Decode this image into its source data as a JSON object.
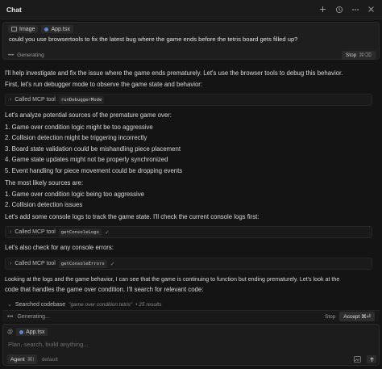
{
  "header": {
    "title": "Chat",
    "icons": [
      "plus-icon",
      "history-icon",
      "more-icon",
      "close-icon"
    ]
  },
  "message": {
    "chips": {
      "image": "Image",
      "file": "App.tsx"
    },
    "text": "could you use browsertools to fix the latest bug where the game ends before the tetris board gets filled up?",
    "status": "Generating",
    "stop_label": "Stop",
    "stop_shortcut": "⌘⌫"
  },
  "conversation": {
    "p1": "I'll help investigate and fix the issue where the game ends prematurely. Let's use the browser tools to debug this behavior.",
    "p2": "First, let's run debugger mode to observe the game state and behavior:",
    "tool1": {
      "label": "Called MCP tool",
      "name": "runDebuggerMode"
    },
    "p3": "Let's analyze potential sources of the premature game over:",
    "list1": [
      "1. Game over condition logic might be too aggressive",
      "2. Collision detection might be triggering incorrectly",
      "3. Board state validation could be mishandling piece placement",
      "4. Game state updates might not be properly synchronized",
      "5. Event handling for piece movement could be dropping events"
    ],
    "p4": "The most likely sources are:",
    "list2": [
      "1. Game over condition logic being too aggressive",
      "2. Collision detection issues"
    ],
    "p5": "Let's add some console logs to track the game state. I'll check the current console logs first:",
    "tool2": {
      "label": "Called MCP tool",
      "name": "getConsoleLogs"
    },
    "p6": "Let's also check for any console errors:",
    "tool3": {
      "label": "Called MCP tool",
      "name": "getConsoleErrors"
    },
    "p7a": "Looking at the logs and the game behavior, I can see that the game is continuing to function but ending prematurely. Let's look at the",
    "p7b": "code that handles the game over condition. I'll search for relevant code:",
    "search": {
      "label": "Searched codebase",
      "query": "\"game over condition tetris\"",
      "results": "• 25 results"
    }
  },
  "status_bar": {
    "generating": "Generating...",
    "stop": "Stop",
    "accept": "Accept ⌘⏎"
  },
  "composer": {
    "context_file": "App.tsx",
    "placeholder": "Plan, search, build anything...",
    "mode": "Agent",
    "mode_shortcut": "⌘I",
    "model": "default"
  }
}
